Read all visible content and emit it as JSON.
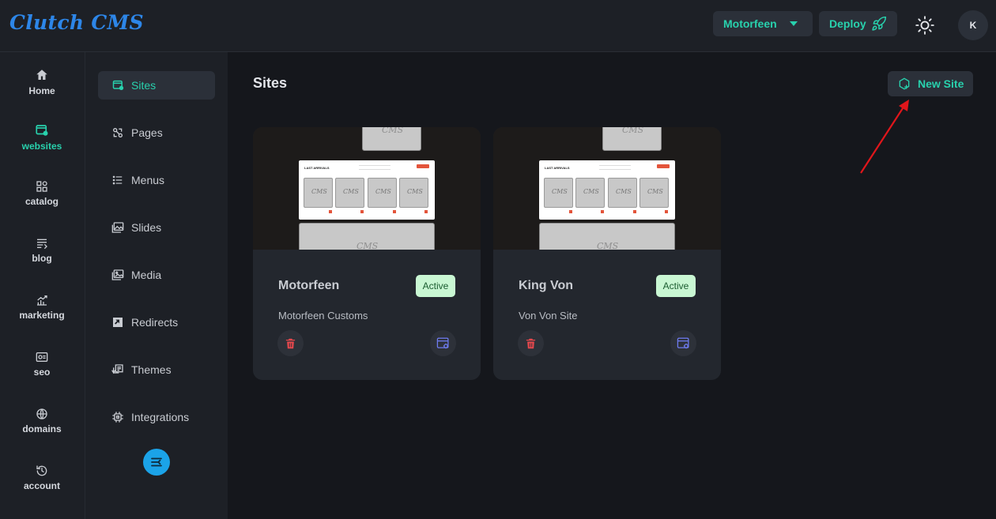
{
  "app": {
    "brand": "Clutch CMS"
  },
  "header": {
    "site_selector_value": "Motorfeen",
    "deploy_label": "Deploy",
    "avatar_initial": "K"
  },
  "rail": {
    "items": [
      {
        "label": "Home",
        "icon": "home-icon"
      },
      {
        "label": "websites",
        "icon": "websites-icon",
        "active": true
      },
      {
        "label": "catalog",
        "icon": "catalog-icon"
      },
      {
        "label": "blog",
        "icon": "blog-icon"
      },
      {
        "label": "marketing",
        "icon": "marketing-icon"
      },
      {
        "label": "seo",
        "icon": "seo-icon"
      },
      {
        "label": "domains",
        "icon": "globe-icon"
      },
      {
        "label": "account",
        "icon": "history-icon"
      }
    ]
  },
  "subnav": {
    "items": [
      {
        "label": "Sites",
        "icon": "sites-icon",
        "active": true
      },
      {
        "label": "Pages",
        "icon": "pages-icon"
      },
      {
        "label": "Menus",
        "icon": "menus-icon"
      },
      {
        "label": "Slides",
        "icon": "slides-icon"
      },
      {
        "label": "Media",
        "icon": "media-icon"
      },
      {
        "label": "Redirects",
        "icon": "redirects-icon"
      },
      {
        "label": "Themes",
        "icon": "themes-icon"
      },
      {
        "label": "Integrations",
        "icon": "integrations-icon"
      }
    ]
  },
  "main": {
    "title": "Sites",
    "new_site_label": "New Site",
    "sites": [
      {
        "name": "Motorfeen",
        "status": "Active",
        "description": "Motorfeen Customs"
      },
      {
        "name": "King Von",
        "status": "Active",
        "description": "Von Von Site"
      }
    ],
    "preview": {
      "watermark": "CMS",
      "section_heading": "LAST ARRIVALS"
    }
  },
  "colors": {
    "accent": "#28d1ad",
    "brand": "#2d86e8",
    "badge_bg": "#c9f7d3",
    "delete": "#e5484d",
    "config": "#6f7cf2",
    "annotation_arrow": "#e0161b"
  }
}
